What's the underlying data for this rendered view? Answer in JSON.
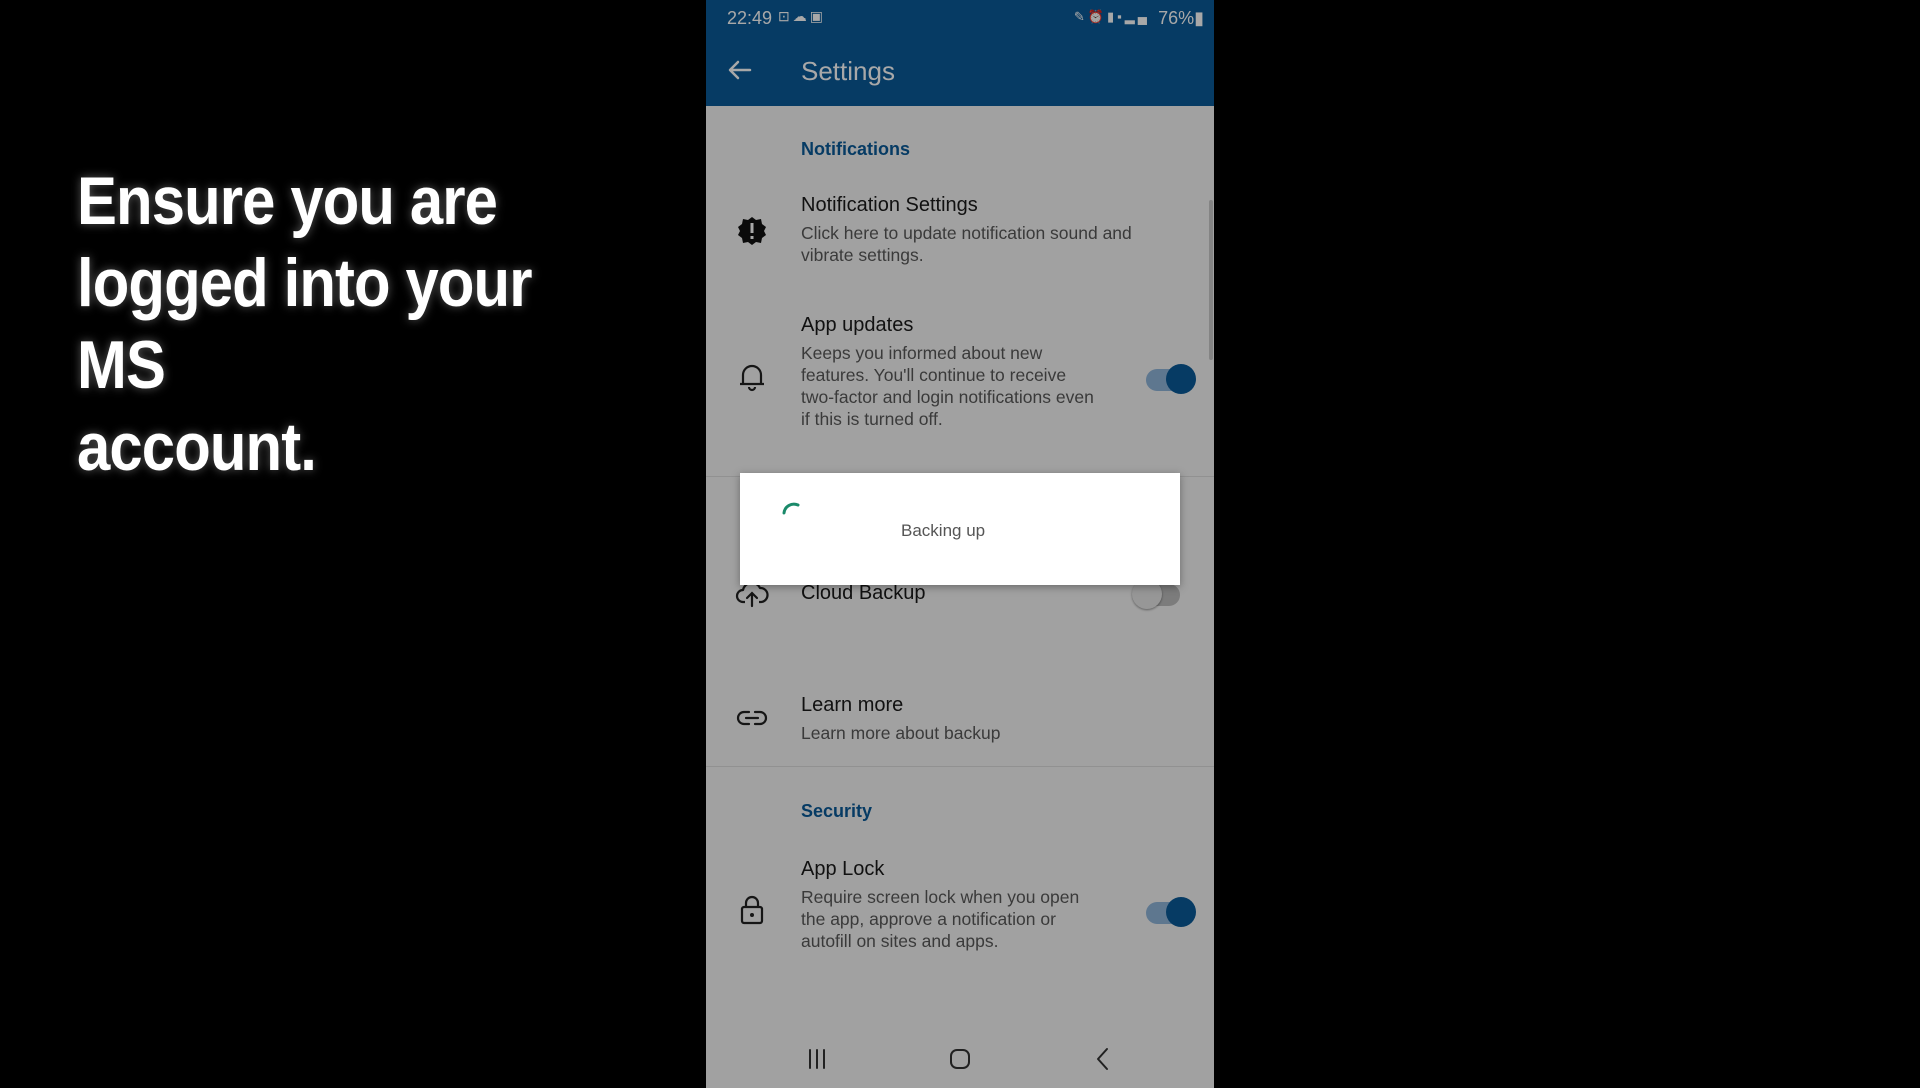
{
  "caption": {
    "line1": "Ensure you are",
    "line2": "logged into your MS",
    "line3": "account."
  },
  "status_bar": {
    "time": "22:49",
    "left_icons": [
      "screenshot-icon",
      "cloud-icon",
      "gallery-icon"
    ],
    "right_icons": [
      "pen-icon",
      "alarm-icon",
      "volte-icon",
      "5g-icon",
      "signal-icon"
    ],
    "battery": "76%"
  },
  "app_bar": {
    "title": "Settings"
  },
  "sections": {
    "notifications": "Notifications",
    "security": "Security"
  },
  "rows": {
    "notification_settings": {
      "title": "Notification Settings",
      "subtitle_line1": "Click here to update notification sound and",
      "subtitle_line2": "vibrate settings.",
      "icon": "badge-alert-icon"
    },
    "app_updates": {
      "title": "App updates",
      "subtitle_line1": "Keeps you informed about new",
      "subtitle_line2": "features. You'll continue to receive",
      "subtitle_line3": "two-factor and login notifications even",
      "subtitle_line4": "if this is turned off.",
      "icon": "bell-icon",
      "toggle": true
    },
    "cloud_backup": {
      "title": "Cloud Backup",
      "icon": "cloud-upload-icon",
      "toggle": false
    },
    "learn_more": {
      "title": "Learn more",
      "subtitle": "Learn more about backup",
      "icon": "link-icon"
    },
    "app_lock": {
      "title": "App Lock",
      "subtitle_line1": "Require screen lock when you open",
      "subtitle_line2": "the app, approve a notification or",
      "subtitle_line3": "autofill on sites and apps.",
      "icon": "lock-icon",
      "toggle": true
    }
  },
  "dialog": {
    "message": "Backing up"
  },
  "colors": {
    "brand": "#0a5a98",
    "spinner": "#1a8a6a"
  }
}
